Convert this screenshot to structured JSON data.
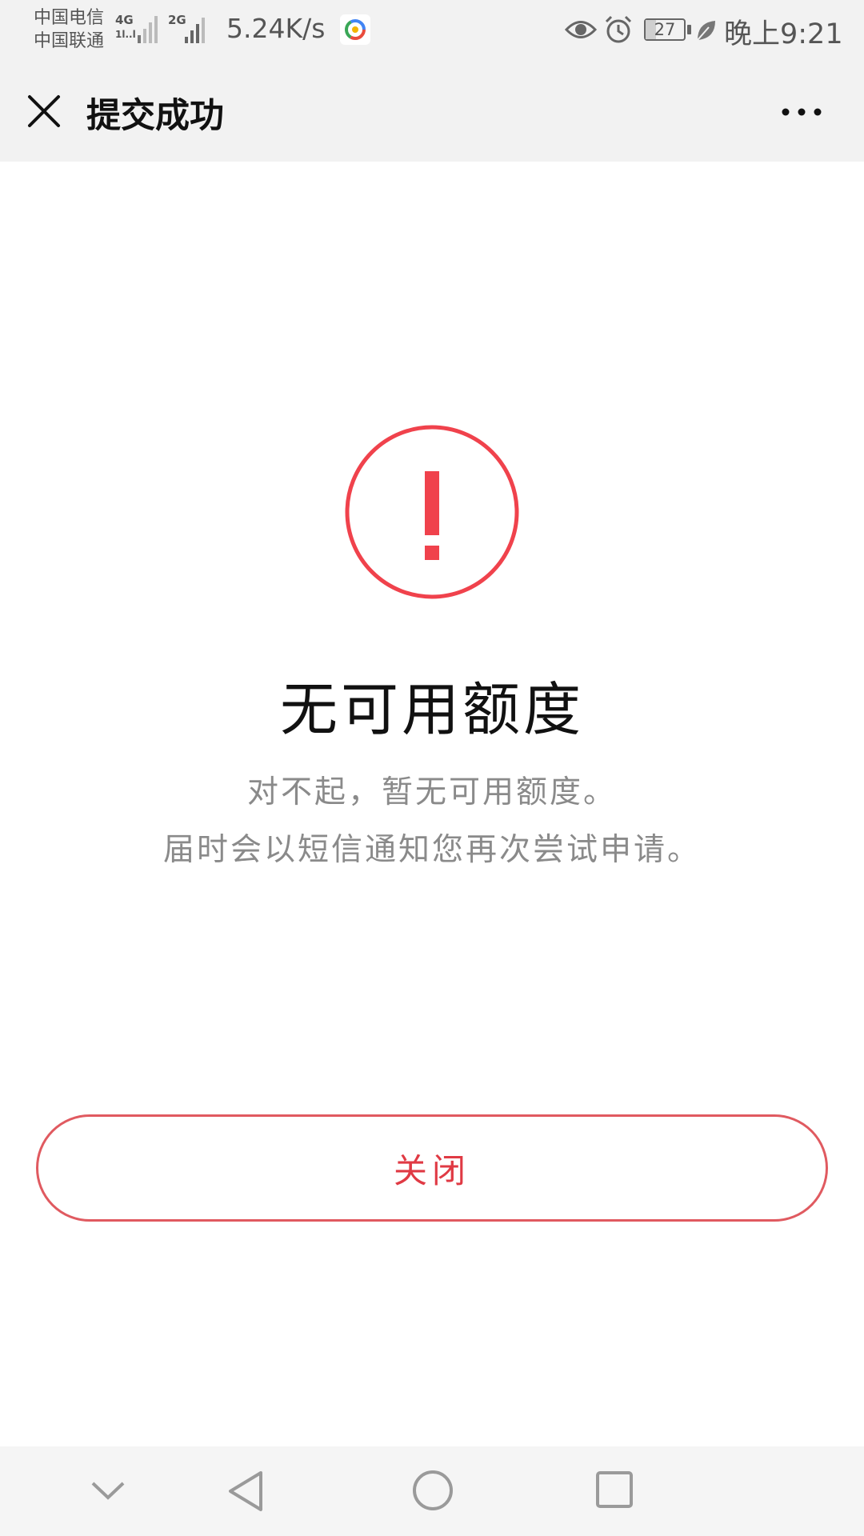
{
  "status_bar": {
    "carrier_1": "中国电信",
    "carrier_2": "中国联通",
    "signal_1_type": "4G",
    "signal_1_sub": "1l..l",
    "signal_2_type": "2G",
    "net_speed": "5.24K/s",
    "battery_level": "27",
    "battery_fraction": 0.27,
    "time": "晚上9:21",
    "icons": [
      "eye-icon",
      "alarm-icon",
      "leaf-icon"
    ]
  },
  "nav": {
    "title": "提交成功",
    "close_icon": "close-icon",
    "more_icon": "more-icon"
  },
  "result": {
    "icon": "alert-icon",
    "icon_color": "#f0424c",
    "title": "无可用额度",
    "desc_line1": "对不起，暂无可用额度。",
    "desc_line2": "届时会以短信通知您再次尝试申请。"
  },
  "actions": {
    "close_label": "关闭",
    "accent_color": "#e03a44"
  },
  "system_nav": {
    "icons": [
      "collapse-icon",
      "back-icon",
      "home-icon",
      "recent-apps-icon"
    ]
  }
}
